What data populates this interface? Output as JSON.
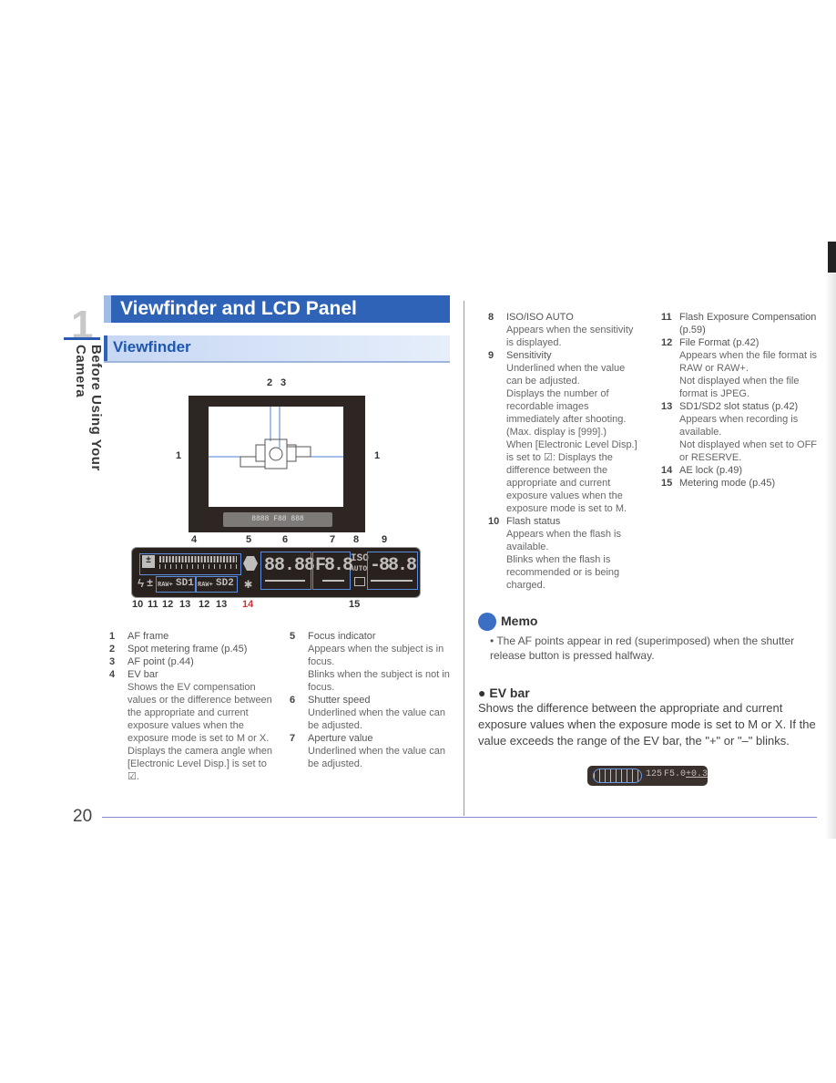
{
  "chapter": {
    "number": "1",
    "title": "Before Using Your Camera"
  },
  "heading1": "Viewfinder and LCD Panel",
  "heading2": "Viewfinder",
  "diagram": {
    "vf_labels": {
      "n2": "2",
      "n3": "3",
      "left1": "1",
      "right1": "1"
    },
    "vf_lcd_text": "8888 F88 888",
    "top_labels": [
      "4",
      "5",
      "6",
      "7",
      "8",
      "9"
    ],
    "bottom_labels": [
      "10",
      "11",
      "12",
      "13",
      "12",
      "13",
      "14",
      "15"
    ],
    "lcd": {
      "shutter": "88.88",
      "aperture": "F8.8",
      "iso": "ISO",
      "auto": "AUTO",
      "sensitivity": "-88.8",
      "raw1": "RAW+",
      "sd1": "SD1",
      "raw2": "RAW+",
      "sd2": "SD2",
      "ae_lock": "✱",
      "flash": "ϟ",
      "flash_comp": "±"
    }
  },
  "left_items": [
    {
      "num": "1",
      "title": "AF frame",
      "desc": []
    },
    {
      "num": "2",
      "title": "Spot metering frame (p.45)",
      "desc": []
    },
    {
      "num": "3",
      "title": "AF point (p.44)",
      "desc": []
    },
    {
      "num": "4",
      "title": "EV bar",
      "desc": [
        "Shows the EV compensation values or the difference between the appropriate and current exposure values when the exposure mode is set to M or X.",
        "Displays the camera angle when [Electronic Level Disp.] is set to ☑."
      ]
    }
  ],
  "mid_items": [
    {
      "num": "5",
      "title": "Focus indicator",
      "desc": [
        "Appears when the subject is in focus.",
        "Blinks when the subject is not in focus."
      ]
    },
    {
      "num": "6",
      "title": "Shutter speed",
      "desc": [
        "Underlined when the value can be adjusted."
      ]
    },
    {
      "num": "7",
      "title": "Aperture value",
      "desc": [
        "Underlined when the value can be adjusted."
      ]
    }
  ],
  "right_items_a": [
    {
      "num": "8",
      "title": "ISO/ISO AUTO",
      "desc": [
        "Appears when the sensitivity is displayed."
      ]
    },
    {
      "num": "9",
      "title": "Sensitivity",
      "desc": [
        "Underlined when the value can be adjusted.",
        "Displays the number of recordable images immediately after shooting. (Max. display is [999].)",
        "When [Electronic Level Disp.] is set to ☑: Displays the difference between the appropriate and current exposure values when the exposure mode is set to M."
      ]
    },
    {
      "num": "10",
      "title": "Flash status",
      "desc": [
        "Appears when the flash is available.",
        "Blinks when the flash is recommended or is being charged."
      ]
    }
  ],
  "right_items_b": [
    {
      "num": "11",
      "title": "Flash Exposure Compensation (p.59)",
      "desc": []
    },
    {
      "num": "12",
      "title": "File Format (p.42)",
      "desc": [
        "Appears when the file format is RAW or RAW+.",
        "Not displayed when the file format is JPEG."
      ]
    },
    {
      "num": "13",
      "title": "SD1/SD2 slot status (p.42)",
      "desc": [
        "Appears when recording is available.",
        "Not displayed when set to OFF or RESERVE."
      ]
    },
    {
      "num": "14",
      "title": "AE lock (p.49)",
      "desc": []
    },
    {
      "num": "15",
      "title": "Metering mode (p.45)",
      "desc": []
    }
  ],
  "memo": {
    "title": "Memo",
    "text": "The AF points appear in red (superimposed) when the shutter release button is pressed halfway."
  },
  "ev_bar": {
    "title": "EV bar",
    "text": "Shows the difference between the appropriate and current exposure values when the exposure mode is set to M or X. If the value exceeds the range of the EV bar, the \"+\" or \"–\" blinks.",
    "lcd_shutter": "125",
    "lcd_aperture": "F5.0",
    "lcd_ev": "+0.3"
  },
  "page_number": "20"
}
